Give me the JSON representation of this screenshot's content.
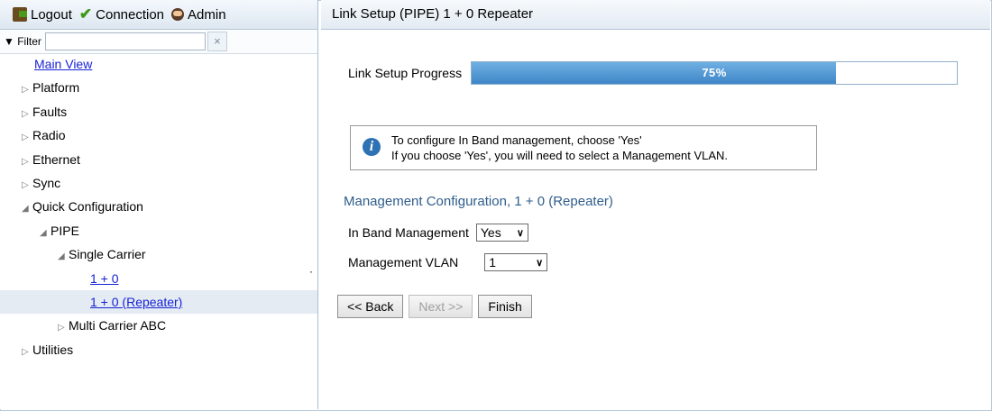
{
  "topbar": {
    "logout_label": "Logout",
    "connection_label": "Connection",
    "admin_label": "Admin"
  },
  "filter": {
    "label": "▼ Filter",
    "value": "",
    "clear_glyph": "×"
  },
  "tree": {
    "main_view": "Main View",
    "items": [
      {
        "label": "Platform",
        "twisty": "▷"
      },
      {
        "label": "Faults",
        "twisty": "▷"
      },
      {
        "label": "Radio",
        "twisty": "▷"
      },
      {
        "label": "Ethernet",
        "twisty": "▷"
      },
      {
        "label": "Sync",
        "twisty": "▷"
      },
      {
        "label": "Quick Configuration",
        "twisty": "◢"
      },
      {
        "label": "PIPE",
        "twisty": "◢"
      },
      {
        "label": "Single Carrier",
        "twisty": "◢"
      },
      {
        "label": "1 + 0",
        "twisty": ""
      },
      {
        "label": "1 + 0 (Repeater)",
        "twisty": ""
      },
      {
        "label": "Multi Carrier ABC",
        "twisty": "▷"
      },
      {
        "label": "Utilities",
        "twisty": "▷"
      }
    ]
  },
  "main": {
    "title": "Link Setup (PIPE) 1 + 0 Repeater",
    "progress_label": "Link Setup Progress",
    "progress_value": 0.75,
    "progress_text": "75%",
    "info_line1": "To configure In Band management, choose 'Yes'",
    "info_line2": "If you choose 'Yes', you will need to select a Management VLAN.",
    "section_title": "Management Configuration, 1 + 0 (Repeater)",
    "in_band_label": "In Band Management",
    "in_band_value": "Yes",
    "vlan_label": "Management VLAN",
    "vlan_value": "1",
    "back_label": "<< Back",
    "next_label": "Next >>",
    "finish_label": "Finish"
  },
  "colors": {
    "accent": "#2f5d8c",
    "progress_fill": "#4a90d0",
    "link": "#1722d6",
    "selected_row": "#e4ebf3"
  }
}
